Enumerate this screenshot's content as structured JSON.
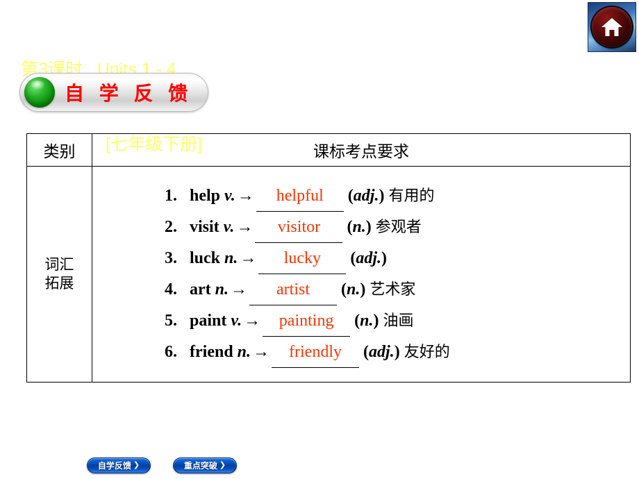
{
  "header": {
    "title_line1": "第3课时   Units 1 - 4",
    "title_line2": "[七年级下册]",
    "title_color": "#ffff66",
    "home_icon": "home-icon"
  },
  "section_banner": {
    "label": "自 学 反 馈",
    "text_color": "#ff0000",
    "bullet_color": "#25b325"
  },
  "table": {
    "headers": {
      "category": "类别",
      "requirement": "课标考点要求"
    },
    "category_label": "词汇\n拓展",
    "category_label_line1": "词汇",
    "category_label_line2": "拓展",
    "items": [
      {
        "num": "1.",
        "base": "help",
        "pos": "v.",
        "arrow": "→",
        "answer": "helpful",
        "answer_pos": "adj.",
        "meaning": "有用的"
      },
      {
        "num": "2.",
        "base": "visit",
        "pos": "v.",
        "arrow": "→",
        "answer": "visitor",
        "answer_pos": "n.",
        "meaning": "参观者"
      },
      {
        "num": "3.",
        "base": "luck",
        "pos": "n.",
        "arrow": "→",
        "answer": "lucky",
        "answer_pos": "adj.",
        "meaning": ""
      },
      {
        "num": "4.",
        "base": "art",
        "pos": "n.",
        "arrow": "→",
        "answer": "artist",
        "answer_pos": "n.",
        "meaning": "艺术家"
      },
      {
        "num": "5.",
        "base": "paint",
        "pos": "v.",
        "arrow": "→",
        "answer": "painting",
        "answer_pos": "n.",
        "meaning": "油画"
      },
      {
        "num": "6.",
        "base": "friend",
        "pos": "n.",
        "arrow": "→",
        "answer": "friendly",
        "answer_pos": "adj.",
        "meaning": "友好的"
      }
    ],
    "answer_color": "#ff3300"
  },
  "footer_nav": {
    "buttons": [
      {
        "label": "自学反馈",
        "chevron": "❯"
      },
      {
        "label": "重点突破",
        "chevron": "❯"
      }
    ],
    "button_color": "#0b5bd3"
  }
}
